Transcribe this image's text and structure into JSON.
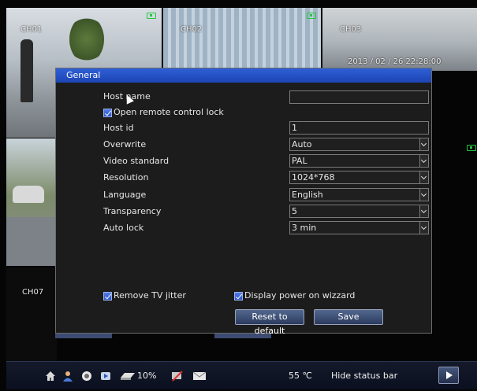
{
  "cameras": {
    "ch01": "CH01",
    "ch02": "CH02",
    "ch03": "CH03",
    "ch07": "CH07",
    "ch03_timestamp": "2013 / 02 / 26 22:28:00"
  },
  "dialog": {
    "title": "General",
    "host_name": {
      "label": "Host name",
      "value": ""
    },
    "remote_lock": {
      "label": "Open remote control lock",
      "checked": true
    },
    "host_id": {
      "label": "Host id",
      "value": "1"
    },
    "overwrite": {
      "label": "Overwrite",
      "value": "Auto"
    },
    "video_standard": {
      "label": "Video standard",
      "value": "PAL"
    },
    "resolution": {
      "label": "Resolution",
      "value": "1024*768"
    },
    "language": {
      "label": "Language",
      "value": "English"
    },
    "transparency": {
      "label": "Transparency",
      "value": "5"
    },
    "auto_lock": {
      "label": "Auto lock",
      "value": "3 min"
    },
    "remove_tv_jitter": {
      "label": "Remove TV jitter",
      "checked": true
    },
    "display_power_on_wizard": {
      "label": "Display power on wizzard",
      "checked": true
    },
    "reset_button": "Reset to default",
    "save_button": "Save"
  },
  "statusbar": {
    "icons": [
      "home-icon",
      "user-icon",
      "record-icon",
      "playback-icon",
      "hdd-icon",
      "network-icon",
      "mail-icon"
    ],
    "hdd_percent": "10%",
    "temperature": "55 ℃",
    "hide_label": "Hide status bar"
  },
  "colors": {
    "title_bar": "#1d44b3",
    "dialog_bg": "#1c1c1c",
    "rec_indicator": "#22c840"
  }
}
